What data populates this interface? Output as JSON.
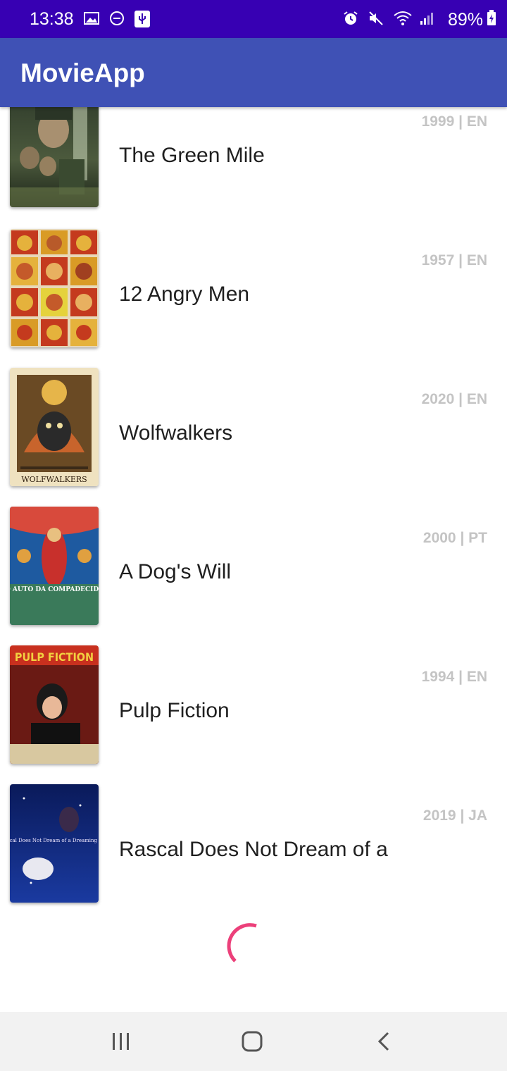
{
  "status_bar": {
    "time": "13:38",
    "battery": "89%",
    "left_icons": [
      "image-icon",
      "do-not-disturb-icon",
      "usb-icon"
    ],
    "right_icons": [
      "alarm-icon",
      "mute-icon",
      "wifi-icon",
      "signal-icon"
    ]
  },
  "app_bar": {
    "title": "MovieApp"
  },
  "movies": [
    {
      "title": "The Green Mile",
      "meta": "1999 | EN",
      "poster": "the-green-mile-poster"
    },
    {
      "title": "12 Angry Men",
      "meta": "1957 | EN",
      "poster": "12-angry-men-poster"
    },
    {
      "title": "Wolfwalkers",
      "meta": "2020 | EN",
      "poster": "wolfwalkers-poster",
      "poster_text": "WOLFWALKERS"
    },
    {
      "title": "A Dog's Will",
      "meta": "2000 | PT",
      "poster": "a-dogs-will-poster",
      "poster_text": "O AUTO DA COMPADECIDA"
    },
    {
      "title": "Pulp Fiction",
      "meta": "1994 | EN",
      "poster": "pulp-fiction-poster",
      "poster_text": "PULP FICTION"
    },
    {
      "title": "Rascal Does Not Dream of a",
      "meta": "2019 | JA",
      "poster": "rascal-poster",
      "poster_text": "Rascal Does Not Dream of a Dreaming Girl"
    }
  ],
  "colors": {
    "status_bar": "#3700b3",
    "app_bar": "#3f51b5",
    "spinner": "#ec407a",
    "meta_text": "#c4c4c4"
  },
  "nav_bar": {
    "buttons": [
      "recent-apps-icon",
      "home-icon",
      "back-icon"
    ]
  }
}
